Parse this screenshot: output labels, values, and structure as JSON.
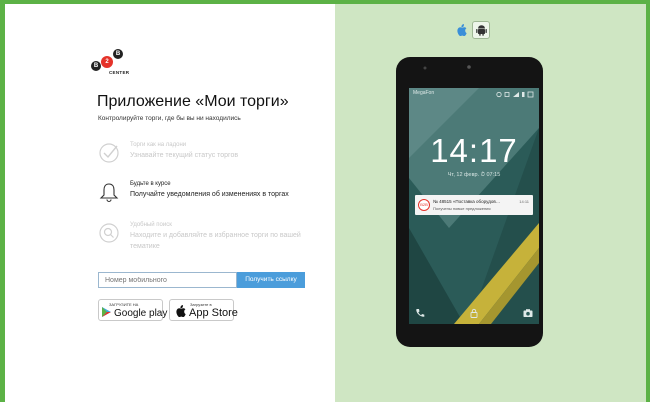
{
  "logo": {
    "letters": [
      "B",
      "2",
      "B"
    ],
    "caption": "CENTER"
  },
  "promo": {
    "title": "Приложение «Мои торги»",
    "subtitle": "Контролируйте торги, где бы вы ни находились"
  },
  "features": [
    {
      "heading": "Торги как на ладони",
      "text": "Узнавайте текущий статус торгов",
      "icon": "check-circle-icon",
      "active": false
    },
    {
      "heading": "Будьте в курсе",
      "text": "Получайте уведомления об изменениях в торгах",
      "icon": "bell-icon",
      "active": true
    },
    {
      "heading": "Удобный поиск",
      "text": "Находите и добавляйте в избранное торги по вашей тематике",
      "icon": "search-icon",
      "active": false
    }
  ],
  "form": {
    "phone_placeholder": "Номер мобильного",
    "submit_label": "Получить ссылку"
  },
  "stores": {
    "google": {
      "small": "ЗАГРУЗИТЕ НА",
      "big": "Google play"
    },
    "apple": {
      "small": "Загрузите в",
      "big": "App Store"
    }
  },
  "platforms": {
    "apple_icon": "apple-icon",
    "android_icon": "android-icon",
    "selected": "android"
  },
  "phone": {
    "carrier": "MegaFon",
    "time": "14:17",
    "date": "Чт, 12 февр.",
    "alarm": "07:15",
    "notification": {
      "badge": "B2B",
      "title": "№ 48515 «Поставка оборудов…",
      "subtitle": "Получены новые предложения",
      "time": "14:11"
    }
  },
  "colors": {
    "brand_green": "#5cb246",
    "accent_blue": "#4b9ddb",
    "brand_red": "#e5332a",
    "panel_green": "#cfe6c3"
  }
}
